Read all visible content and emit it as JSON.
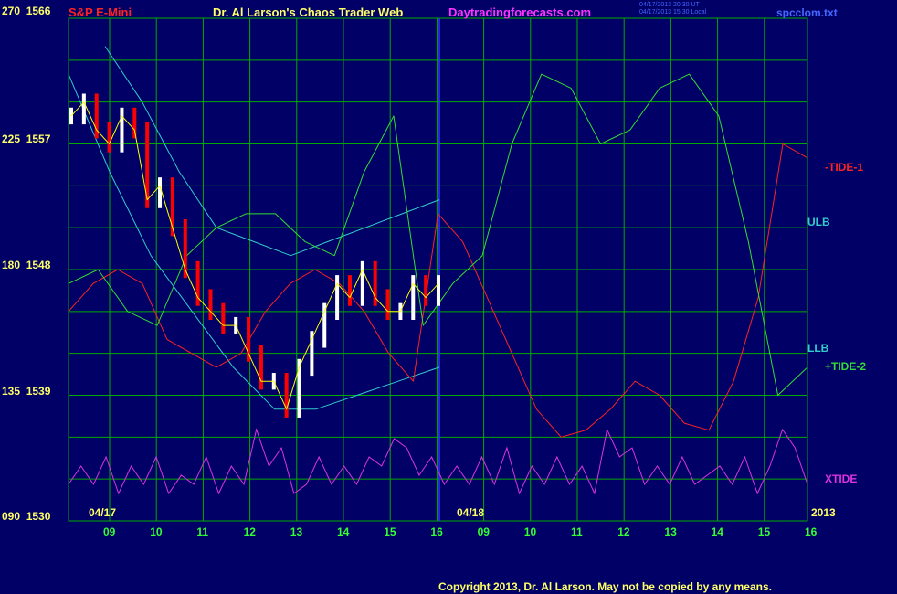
{
  "header": {
    "symbol": "S&P E-Mini",
    "title": "Dr. Al Larson's Chaos Trader Web",
    "site": "Daytradingforecasts.com",
    "timestamp_ut": "04/17/2013 20:30 UT",
    "timestamp_local": "04/17/2013 15:30 Local",
    "file": "spcclom.txt"
  },
  "footer": {
    "copyright": "Copyright 2013, Dr. Al Larson. May not be copied by any means."
  },
  "colors": {
    "background": "#000066",
    "grid": "#00aa00",
    "price_up": "#ffffff",
    "price_down": "#ff0000",
    "tide1": "#ff2222",
    "tide2": "#33dd33",
    "bands": "#33cccc",
    "xtide": "#dd33dd",
    "average": "#ffff00"
  },
  "chart_data": {
    "type": "line",
    "y_axis": {
      "labels": [
        {
          "left": "270",
          "right": "1566"
        },
        {
          "left": "225",
          "right": "1557"
        },
        {
          "left": "180",
          "right": "1548"
        },
        {
          "left": "135",
          "right": "1539"
        },
        {
          "left": "090",
          "right": "1530"
        }
      ],
      "range_price": [
        1530,
        1566
      ],
      "range_tide": [
        90,
        270
      ]
    },
    "x_axis": {
      "hours": [
        "09",
        "10",
        "11",
        "12",
        "13",
        "14",
        "15",
        "16",
        "09",
        "10",
        "11",
        "12",
        "13",
        "14",
        "15",
        "16"
      ],
      "date_labels": [
        "04/17",
        "04/18",
        "2013"
      ]
    },
    "series": [
      {
        "name": "-TIDE-1",
        "color": "#ff2222"
      },
      {
        "name": "ULB",
        "color": "#33cccc"
      },
      {
        "name": "LLB",
        "color": "#33cccc"
      },
      {
        "name": "+TIDE-2",
        "color": "#33dd33"
      },
      {
        "name": "XTIDE",
        "color": "#dd33dd"
      }
    ],
    "tide1_values": [
      1545,
      1547,
      1548,
      1547,
      1543,
      1542,
      1541,
      1542,
      1545,
      1547,
      1548,
      1547,
      1545,
      1542,
      1540,
      1552,
      1550,
      1546,
      1542,
      1538,
      1536,
      1536.5,
      1538,
      1540,
      1539,
      1537,
      1536.5,
      1540,
      1546,
      1557,
      1556
    ],
    "tide2_values": [
      1547,
      1548,
      1545,
      1544,
      1549,
      1551,
      1552,
      1552,
      1550,
      1549,
      1555,
      1559,
      1544,
      1547,
      1549,
      1557,
      1562,
      1561,
      1557,
      1558,
      1561,
      1562,
      1559,
      1550,
      1539,
      1541
    ],
    "ulb_values": [
      1564,
      1560,
      1555,
      1551,
      1550,
      1549,
      1550,
      1551,
      1552,
      1553
    ],
    "llb_values": [
      1562,
      1555,
      1549,
      1545,
      1541,
      1538,
      1538,
      1539,
      1540,
      1541
    ],
    "xtide_values": [
      0.3,
      0.5,
      0.3,
      0.6,
      0.2,
      0.5,
      0.3,
      0.6,
      0.2,
      0.4,
      0.3,
      0.6,
      0.2,
      0.5,
      0.3,
      0.9,
      0.5,
      0.7,
      0.2,
      0.3,
      0.6,
      0.3,
      0.5,
      0.3,
      0.6,
      0.5,
      0.8,
      0.7,
      0.4,
      0.6,
      0.3,
      0.5,
      0.3,
      0.6,
      0.3,
      0.7,
      0.2,
      0.5,
      0.3,
      0.6,
      0.3,
      0.5,
      0.2,
      0.9,
      0.6,
      0.7,
      0.3,
      0.5,
      0.3,
      0.6,
      0.3,
      0.4,
      0.5,
      0.3,
      0.6,
      0.2,
      0.5,
      0.9,
      0.7,
      0.3
    ],
    "price_values": [
      1559,
      1560,
      1558,
      1557,
      1559,
      1558,
      1553,
      1554,
      1551,
      1548,
      1546,
      1545,
      1544,
      1544,
      1542,
      1540,
      1540,
      1538,
      1541,
      1543,
      1545,
      1547,
      1546,
      1548,
      1546,
      1545,
      1545,
      1547,
      1546,
      1547
    ]
  }
}
